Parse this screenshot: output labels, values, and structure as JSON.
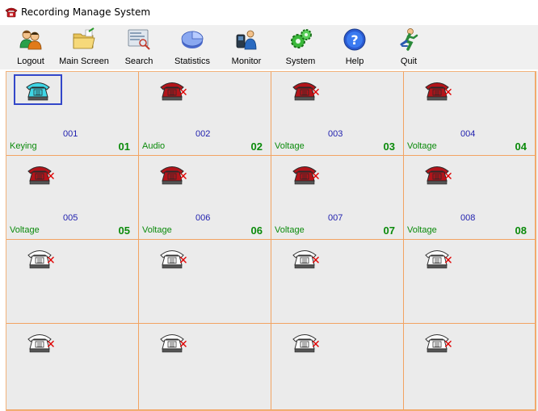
{
  "window": {
    "title": "Recording Manage System",
    "icon": "red-telephone-icon"
  },
  "toolbar": {
    "items": [
      {
        "label": "Logout",
        "icon": "users-logout-icon"
      },
      {
        "label": "Main Screen",
        "icon": "folder-icon"
      },
      {
        "label": "Search",
        "icon": "search-document-icon"
      },
      {
        "label": "Statistics",
        "icon": "pie-chart-icon"
      },
      {
        "label": "Monitor",
        "icon": "monitor-person-icon"
      },
      {
        "label": "System",
        "icon": "gears-icon"
      },
      {
        "label": "Help",
        "icon": "help-icon"
      },
      {
        "label": "Quit",
        "icon": "quit-runner-icon"
      }
    ]
  },
  "channels": [
    {
      "num": "001",
      "status": "Keying",
      "channel": "01",
      "phone_color": "cyan",
      "disconnected": false,
      "selected": true
    },
    {
      "num": "002",
      "status": "Audio",
      "channel": "02",
      "phone_color": "red",
      "disconnected": true
    },
    {
      "num": "003",
      "status": "Voltage",
      "channel": "03",
      "phone_color": "red",
      "disconnected": true
    },
    {
      "num": "004",
      "status": "Voltage",
      "channel": "04",
      "phone_color": "red",
      "disconnected": true
    },
    {
      "num": "005",
      "status": "Voltage",
      "channel": "05",
      "phone_color": "red",
      "disconnected": true
    },
    {
      "num": "006",
      "status": "Voltage",
      "channel": "06",
      "phone_color": "red",
      "disconnected": true
    },
    {
      "num": "007",
      "status": "Voltage",
      "channel": "07",
      "phone_color": "red",
      "disconnected": true
    },
    {
      "num": "008",
      "status": "Voltage",
      "channel": "08",
      "phone_color": "red",
      "disconnected": true
    },
    {
      "num": "",
      "status": "",
      "channel": "",
      "phone_color": "white",
      "disconnected": true
    },
    {
      "num": "",
      "status": "",
      "channel": "",
      "phone_color": "white",
      "disconnected": true
    },
    {
      "num": "",
      "status": "",
      "channel": "",
      "phone_color": "white",
      "disconnected": true
    },
    {
      "num": "",
      "status": "",
      "channel": "",
      "phone_color": "white",
      "disconnected": true
    },
    {
      "num": "",
      "status": "",
      "channel": "",
      "phone_color": "white",
      "disconnected": true
    },
    {
      "num": "",
      "status": "",
      "channel": "",
      "phone_color": "white",
      "disconnected": true
    },
    {
      "num": "",
      "status": "",
      "channel": "",
      "phone_color": "white",
      "disconnected": true
    },
    {
      "num": "",
      "status": "",
      "channel": "",
      "phone_color": "white",
      "disconnected": true
    }
  ],
  "colors": {
    "phone_cyan": "#3fd6e6",
    "phone_red": "#b3141a",
    "phone_white": "#ffffff",
    "status_green": "#0a8a0a",
    "number_blue": "#1f1fae",
    "cell_border": "#f2a362",
    "disconnect_x": "#e00000",
    "selection": "#3347c9"
  }
}
